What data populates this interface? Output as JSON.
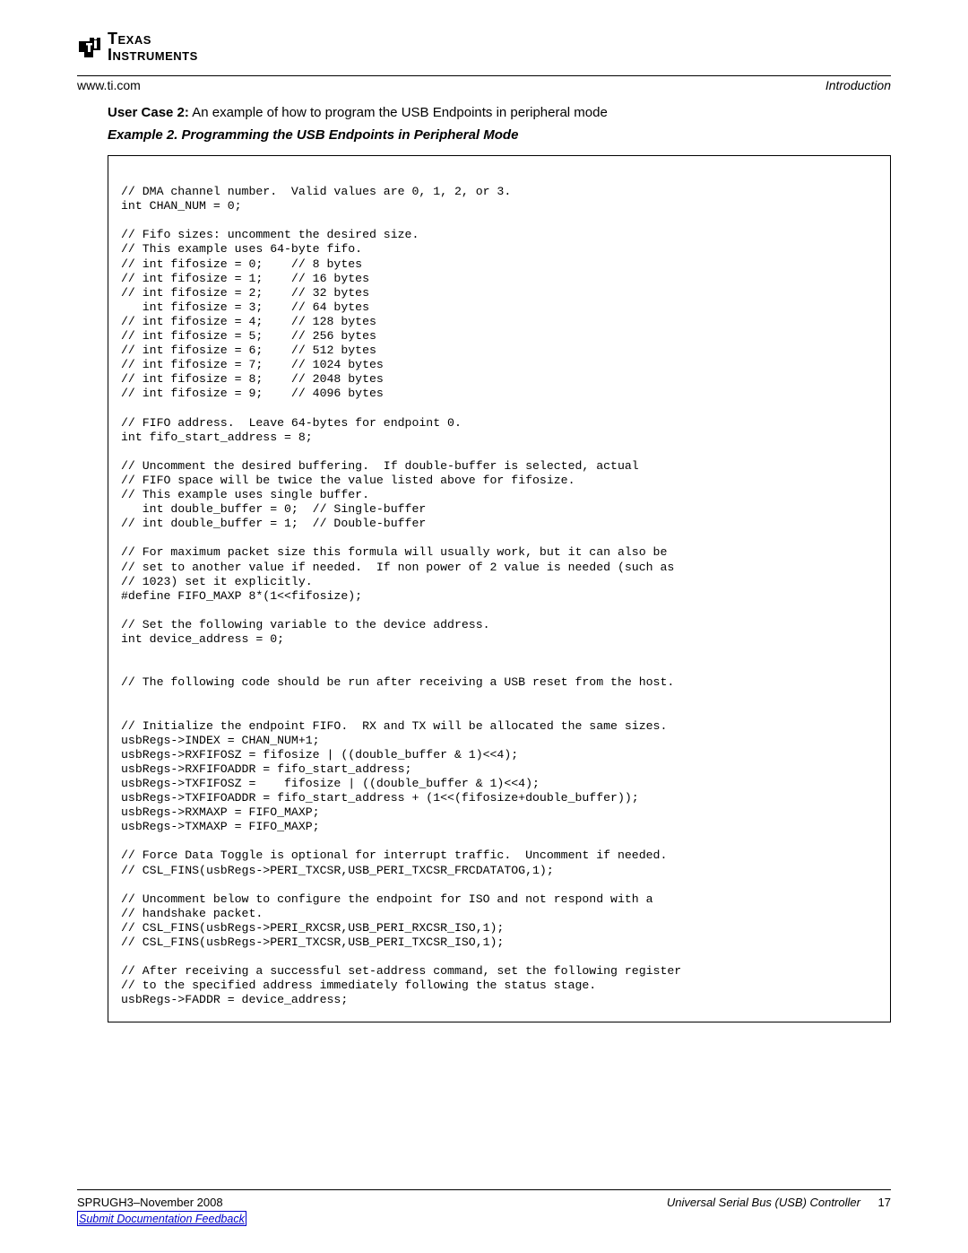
{
  "header": {
    "logo_line1": "Texas",
    "logo_line2": "Instruments",
    "url": "www.ti.com",
    "section": "Introduction"
  },
  "main": {
    "usercase_label": "User Case 2:",
    "usercase_text": " An example of how to program the USB Endpoints in peripheral mode",
    "example_title": "Example 2. Programming the USB Endpoints in Peripheral Mode",
    "code": "\n// DMA channel number.  Valid values are 0, 1, 2, or 3.\nint CHAN_NUM = 0;\n\n// Fifo sizes: uncomment the desired size.\n// This example uses 64-byte fifo.\n// int fifosize = 0;    // 8 bytes\n// int fifosize = 1;    // 16 bytes\n// int fifosize = 2;    // 32 bytes\n   int fifosize = 3;    // 64 bytes\n// int fifosize = 4;    // 128 bytes\n// int fifosize = 5;    // 256 bytes\n// int fifosize = 6;    // 512 bytes\n// int fifosize = 7;    // 1024 bytes\n// int fifosize = 8;    // 2048 bytes\n// int fifosize = 9;    // 4096 bytes\n\n// FIFO address.  Leave 64-bytes for endpoint 0.\nint fifo_start_address = 8;\n\n// Uncomment the desired buffering.  If double-buffer is selected, actual\n// FIFO space will be twice the value listed above for fifosize.\n// This example uses single buffer.\n   int double_buffer = 0;  // Single-buffer\n// int double_buffer = 1;  // Double-buffer\n\n// For maximum packet size this formula will usually work, but it can also be\n// set to another value if needed.  If non power of 2 value is needed (such as\n// 1023) set it explicitly.\n#define FIFO_MAXP 8*(1<<fifosize);\n\n// Set the following variable to the device address.\nint device_address = 0;\n\n\n// The following code should be run after receiving a USB reset from the host.\n\n\n// Initialize the endpoint FIFO.  RX and TX will be allocated the same sizes.\nusbRegs->INDEX = CHAN_NUM+1;\nusbRegs->RXFIFOSZ = fifosize | ((double_buffer & 1)<<4);\nusbRegs->RXFIFOADDR = fifo_start_address;\nusbRegs->TXFIFOSZ =    fifosize | ((double_buffer & 1)<<4);\nusbRegs->TXFIFOADDR = fifo_start_address + (1<<(fifosize+double_buffer));\nusbRegs->RXMAXP = FIFO_MAXP;\nusbRegs->TXMAXP = FIFO_MAXP;\n\n// Force Data Toggle is optional for interrupt traffic.  Uncomment if needed.\n// CSL_FINS(usbRegs->PERI_TXCSR,USB_PERI_TXCSR_FRCDATATOG,1);\n\n// Uncomment below to configure the endpoint for ISO and not respond with a\n// handshake packet.\n// CSL_FINS(usbRegs->PERI_RXCSR,USB_PERI_RXCSR_ISO,1);\n// CSL_FINS(usbRegs->PERI_TXCSR,USB_PERI_TXCSR_ISO,1);\n\n// After receiving a successful set-address command, set the following register\n// to the specified address immediately following the status stage.\nusbRegs->FADDR = device_address;"
  },
  "footer": {
    "docnum": "SPRUGH3–November 2008",
    "title": "Universal Serial Bus (USB) Controller",
    "page": "17",
    "feedback": "Submit Documentation Feedback"
  }
}
